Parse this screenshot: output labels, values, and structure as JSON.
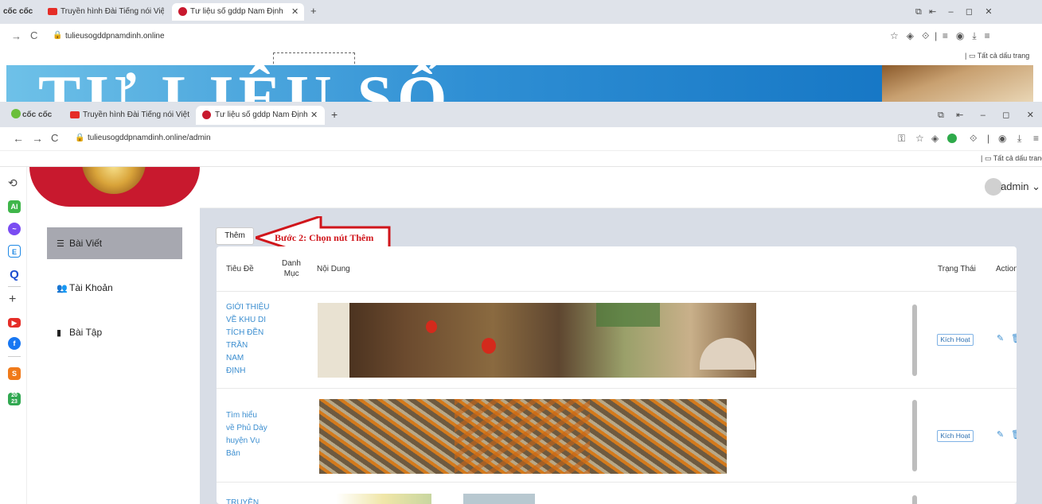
{
  "back_window": {
    "browser_name": "cốc cốc",
    "tabs": [
      {
        "label": "Truyền hình Đài Tiếng nói Việt Na"
      },
      {
        "label": "Tư liệu số gddp Nam Định"
      }
    ],
    "url": "tulieusogddpnamdinh.online",
    "bookmarks_label": "Tất cả dấu trang",
    "banner_text": "TƯ LIỆU SỐ"
  },
  "front_window": {
    "browser_name": "cốc cốc",
    "tabs": [
      {
        "label": "Truyền hình Đài Tiếng nói Việt Na"
      },
      {
        "label": "Tư liệu số gddp Nam Định"
      }
    ],
    "url": "tulieusogddpnamdinh.online/admin",
    "bookmarks_label": "Tất cả dấu trang"
  },
  "app": {
    "user": "admin",
    "nav": [
      {
        "label": "Bài Viết"
      },
      {
        "label": "Tài Khoản"
      },
      {
        "label": "Bài Tập"
      }
    ],
    "add_button": "Thêm",
    "annotation": "Bước 2: Chọn nút Thêm",
    "table": {
      "headers": {
        "title": "Tiêu Đề",
        "category_1": "Danh",
        "category_2": "Mục",
        "content": "Nội Dung",
        "status": "Trạng Thái",
        "action": "Action"
      },
      "rows": [
        {
          "title_lines": [
            "GIỚI THIỆU",
            "VỀ KHU DI",
            "TÍCH ĐỀN",
            "TRẦN",
            "NAM",
            "ĐỊNH"
          ],
          "status": "Kích Hoạt"
        },
        {
          "title_lines": [
            "Tìm hiểu",
            "về Phủ Dày",
            "huyện Vụ",
            "Bản"
          ],
          "status": "Kích Hoạt"
        },
        {
          "title_lines": [
            "TRUYỀN"
          ],
          "status": ""
        }
      ]
    }
  },
  "colors": {
    "accent_red": "#d0151b",
    "link_blue": "#3b8ed0",
    "active_nav": "#a7a8b0",
    "content_bg": "#d8dde6"
  }
}
